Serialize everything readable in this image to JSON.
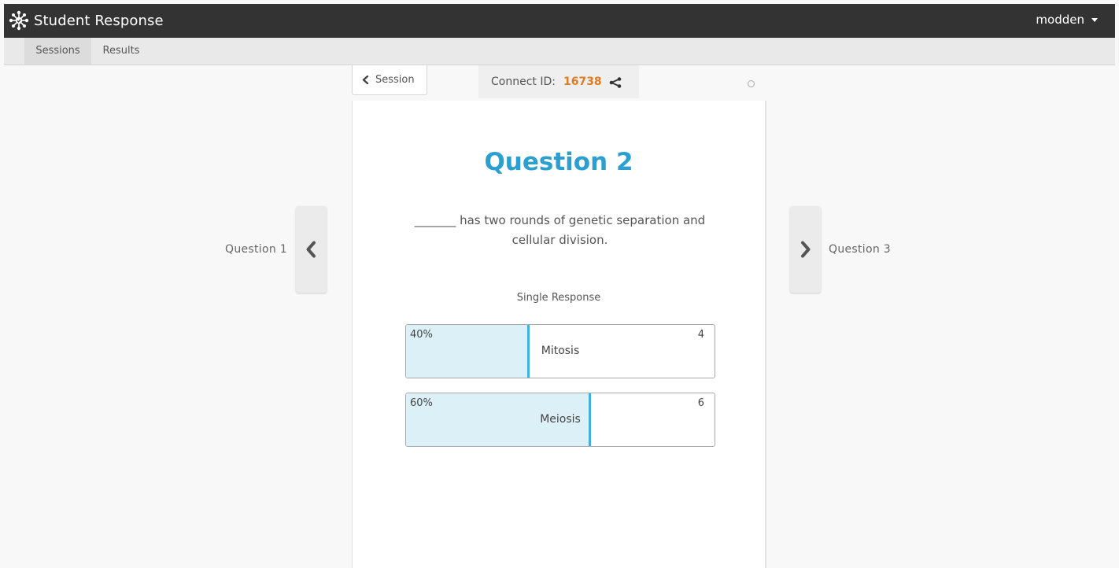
{
  "app": {
    "title": "Student Response",
    "user": "modden"
  },
  "subnav": {
    "tabs": [
      "Sessions",
      "Results"
    ],
    "active": "Sessions"
  },
  "session_button": {
    "label": "Session"
  },
  "connect": {
    "label": "Connect ID:",
    "id": "16738"
  },
  "navigation": {
    "prev_label": "Question 1",
    "next_label": "Question 3"
  },
  "question": {
    "title": "Question 2",
    "text": "_______ has two rounds of genetic separation and cellular division.",
    "response_type": "Single Response",
    "answers": [
      {
        "percent": "40%",
        "count": "4",
        "label": "Mitosis",
        "fraction": 0.4
      },
      {
        "percent": "60%",
        "count": "6",
        "label": "Meiosis",
        "fraction": 0.6
      }
    ]
  },
  "colors": {
    "accent": "#2a9fd0",
    "connect_id": "#e07b1f",
    "bar_fill": "#dcf0f8",
    "bar_edge": "#41b0dd",
    "navbar": "#333333"
  },
  "icons": {
    "brand": "network-logo-icon",
    "session_back": "chevron-left-icon",
    "share": "share-icon",
    "prev": "chevron-left-icon",
    "next": "chevron-right-icon",
    "status": "status-circle-icon",
    "user_caret": "caret-down-icon"
  }
}
